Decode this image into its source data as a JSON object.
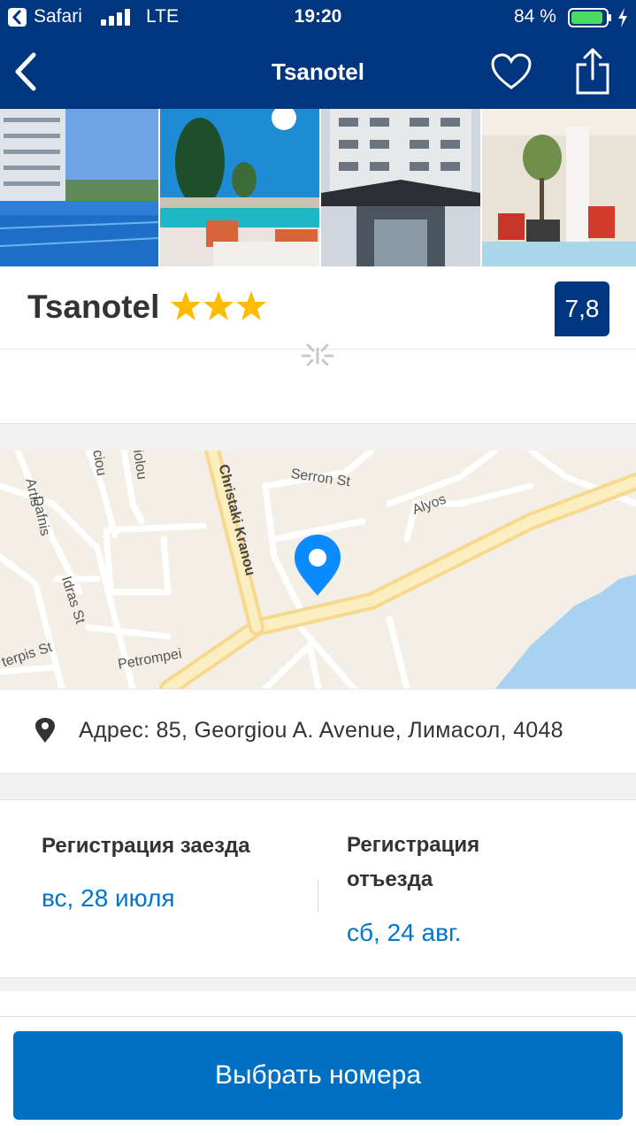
{
  "status_bar": {
    "app": "Safari",
    "carrier": "LTE",
    "time": "19:20",
    "battery": "84 %",
    "battery_color": "#4cd964"
  },
  "nav": {
    "title": "Tsanotel",
    "back_icon": "chevron-left-icon",
    "favorite_icon": "heart-icon",
    "share_icon": "share-icon",
    "background": "#003580"
  },
  "gallery": {
    "photos": [
      "pool-photo",
      "terrace-pool-photo",
      "hotel-facade-photo",
      "lobby-photo"
    ]
  },
  "hotel": {
    "name": "Tsanotel",
    "stars": 3,
    "star_color": "#febb02",
    "score": "7,8"
  },
  "map": {
    "streets": [
      "Artis",
      "Dafnis",
      "Christaki Kranou",
      "Serron St",
      "Alyos",
      "Idras St",
      "Petrompei",
      "terpis St"
    ],
    "street_fragments": [
      "ciou",
      "iolou"
    ],
    "marker_color": "#0a8bff"
  },
  "address": {
    "text": "Адрес: 85, Georgiou A. Avenue, Лимасол, 4048"
  },
  "dates": {
    "checkin_label": "Регистрация заезда",
    "checkin_value": "вс, 28 июля",
    "checkout_label": "Регистрация отъезда",
    "checkout_value": "сб, 24 авг."
  },
  "cta": {
    "label": "Выбрать номера",
    "color": "#0071c2"
  }
}
